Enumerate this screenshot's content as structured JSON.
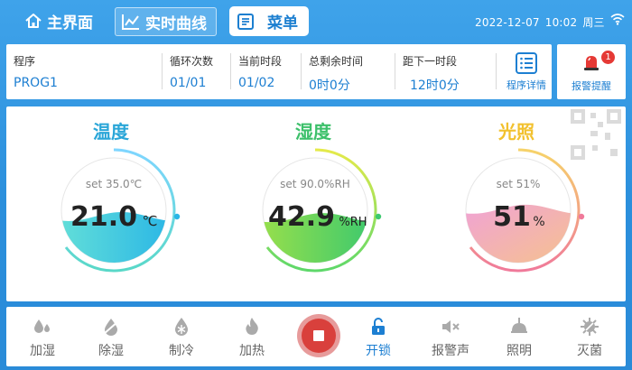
{
  "nav": {
    "home_label": "主界面",
    "curve_label": "实时曲线",
    "menu_label": "菜单"
  },
  "status": {
    "date": "2022-12-07",
    "time": "10:02",
    "weekday": "周三"
  },
  "program": {
    "program_label": "程序",
    "program_value": "PROG1",
    "cycles_label": "循环次数",
    "cycles_value": "01/01",
    "segment_label": "当前时段",
    "segment_value": "01/02",
    "remaining_label": "总剩余时间",
    "remaining_value": "0时0分",
    "next_label": "距下一时段",
    "next_value": "12时0分",
    "detail_label": "程序详情"
  },
  "alarm": {
    "label": "报警提醒",
    "count": "1"
  },
  "gauges": {
    "temperature": {
      "title": "温度",
      "setpoint_text": "set 35.0℃",
      "value": "21.0",
      "unit": "℃",
      "level": 0.44,
      "title_color": "#2aa6d8"
    },
    "humidity": {
      "title": "湿度",
      "setpoint_text": "set 90.0%RH",
      "value": "42.9",
      "unit": "%RH",
      "level": 0.43,
      "title_color": "#3cc06a"
    },
    "light": {
      "title": "光照",
      "setpoint_text": "set 51%",
      "value": "51",
      "unit": "%",
      "level": 0.51,
      "title_color": "#f2c12e"
    }
  },
  "controls": {
    "humidify": "加湿",
    "dehumidify": "除湿",
    "cool": "制冷",
    "heat": "加热",
    "unlock": "开锁",
    "alarm_sound": "报警声",
    "lighting": "照明",
    "sterilize": "灭菌"
  },
  "colors": {
    "accent": "#1d7fd2",
    "background": "#2b8fdc",
    "stop": "#d9403c"
  }
}
